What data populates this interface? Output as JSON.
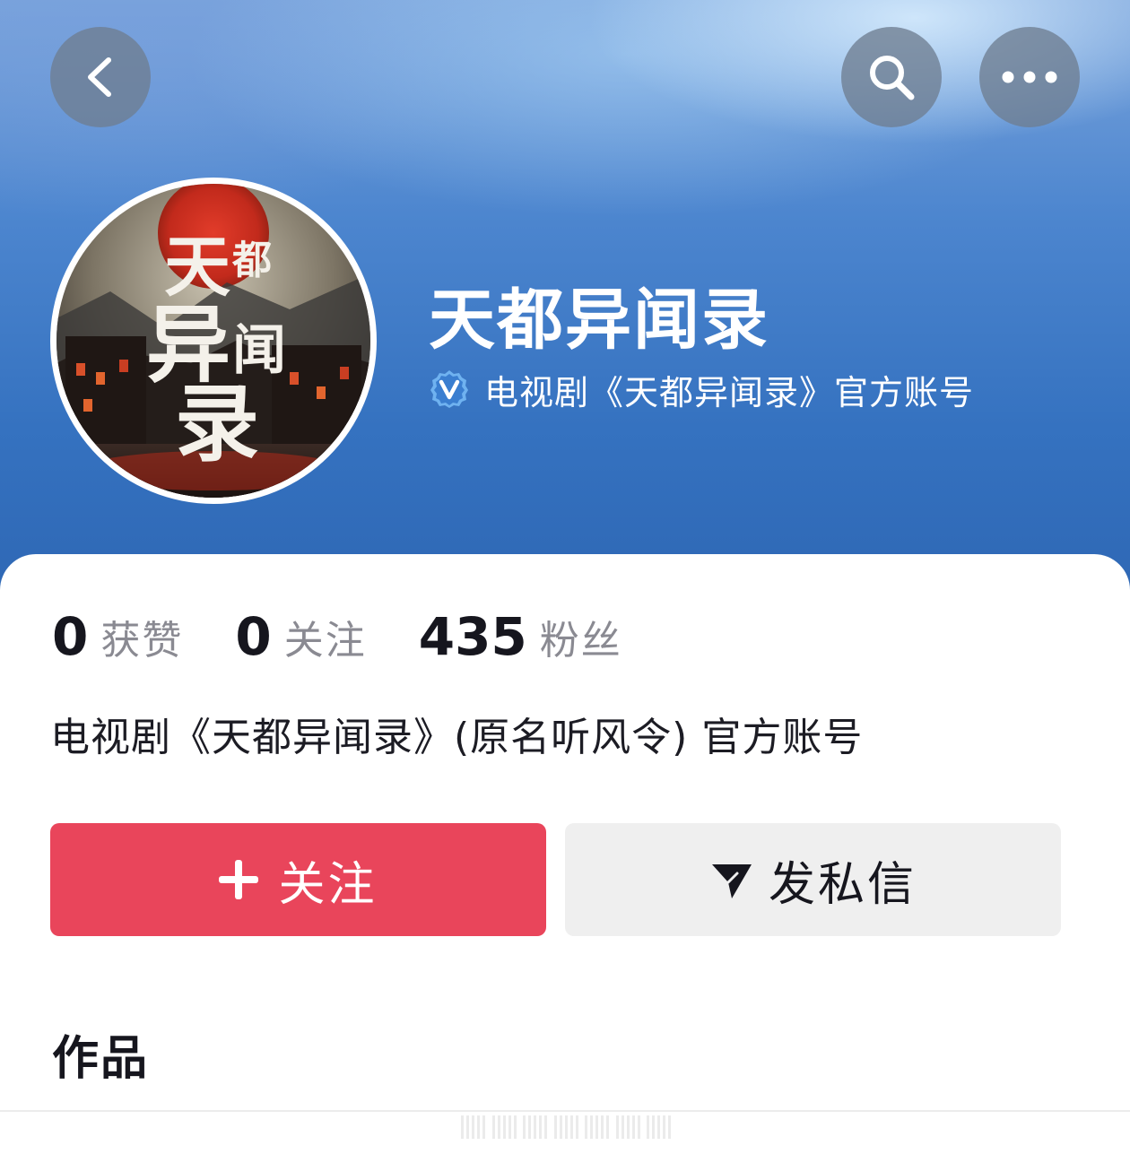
{
  "header": {
    "back_icon": "chevron-left-icon",
    "search_icon": "search-icon",
    "more_icon": "more-horizontal-icon"
  },
  "profile": {
    "name": "天都异闻录",
    "verified_icon": "verified-v-icon",
    "verified_text": "电视剧《天都异闻录》官方账号",
    "avatar_text_1": "天",
    "avatar_text_2": "都",
    "avatar_text_3": "异",
    "avatar_text_4": "闻",
    "avatar_text_5": "录"
  },
  "stats": [
    {
      "value": "0",
      "label": "获赞"
    },
    {
      "value": "0",
      "label": "关注"
    },
    {
      "value": "435",
      "label": "粉丝"
    }
  ],
  "bio": "电视剧《天都异闻录》(原名听风令) 官方账号",
  "actions": {
    "follow_label": "关注",
    "message_label": "发私信"
  },
  "section": {
    "works_title": "作品"
  },
  "colors": {
    "accent": "#e9455b",
    "hero_blue": "#3572c0"
  }
}
